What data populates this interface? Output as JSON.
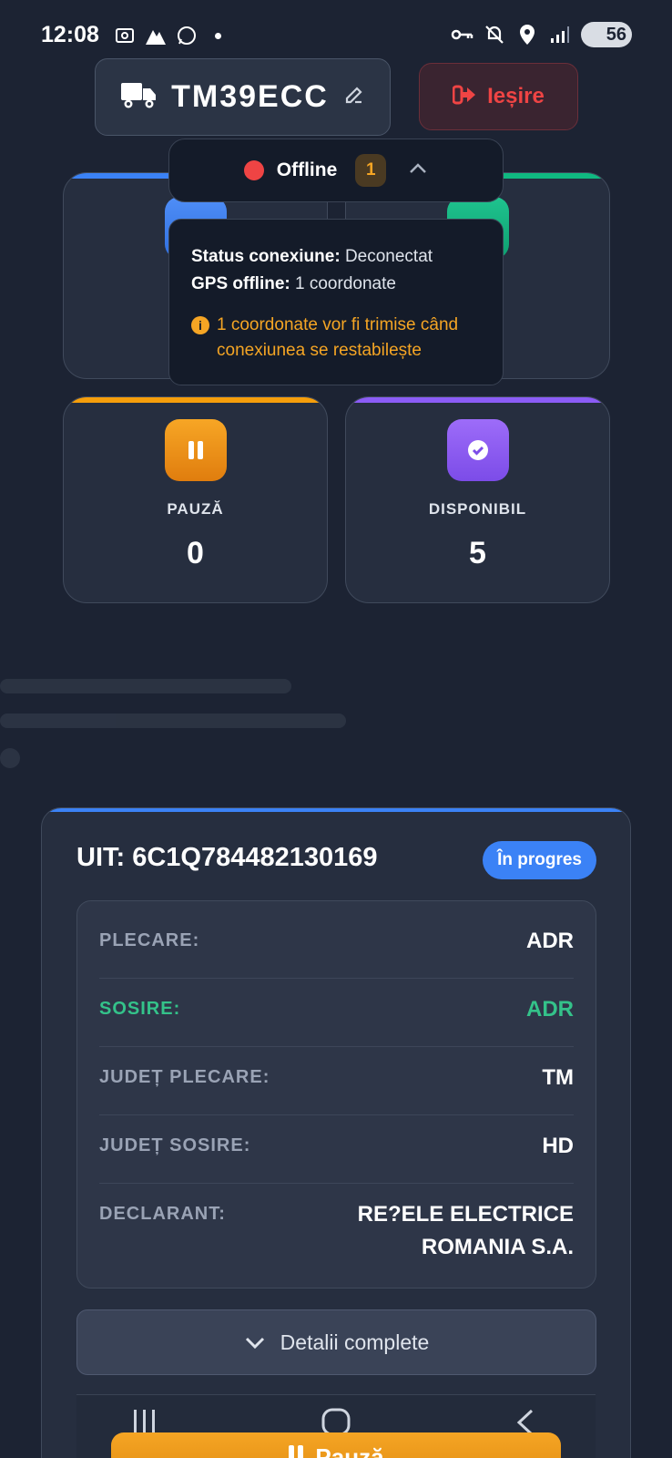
{
  "status_bar": {
    "time": "12:08",
    "battery": "56",
    "icons_left": [
      "screenshot-icon",
      "app-icon",
      "whatsapp-icon",
      "notification-dot"
    ],
    "icons_right": [
      "vpn-key-icon",
      "mute-icon",
      "location-icon",
      "signal-icon",
      "battery-icon"
    ]
  },
  "header": {
    "vehicle_plate": "TM39ECC",
    "exit_label": "Ieșire"
  },
  "offline": {
    "label": "Offline",
    "count": "1",
    "status_label": "Status conexiune:",
    "status_value": "Deconectat",
    "gps_label": "GPS offline:",
    "gps_value": "1 coordonate",
    "warning": "1 coordonate vor fi trimise când conexiunea se restabilește"
  },
  "stats": {
    "pause": {
      "title": "PAUZĂ",
      "value": "0"
    },
    "available": {
      "title": "DISPONIBIL",
      "value": "5"
    }
  },
  "uit": {
    "title": "UIT: 6C1Q784482130169",
    "badge": "În progres",
    "rows": [
      {
        "label": "PLECARE:",
        "value": "ADR"
      },
      {
        "label": "SOSIRE:",
        "value": "ADR"
      },
      {
        "label": "JUDEȚ PLECARE:",
        "value": "TM"
      },
      {
        "label": "JUDEȚ SOSIRE:",
        "value": "HD"
      },
      {
        "label": "DECLARANT:",
        "value": "RE?ELE ELECTRICE ROMANIA S.A."
      }
    ],
    "details_button": "Detalii complete"
  },
  "bottom_action": {
    "label": "Pauză"
  },
  "colors": {
    "blue": "#3b82f6",
    "green": "#10b981",
    "orange": "#f59e0b",
    "purple": "#8b5cf6",
    "red": "#ef4444"
  }
}
